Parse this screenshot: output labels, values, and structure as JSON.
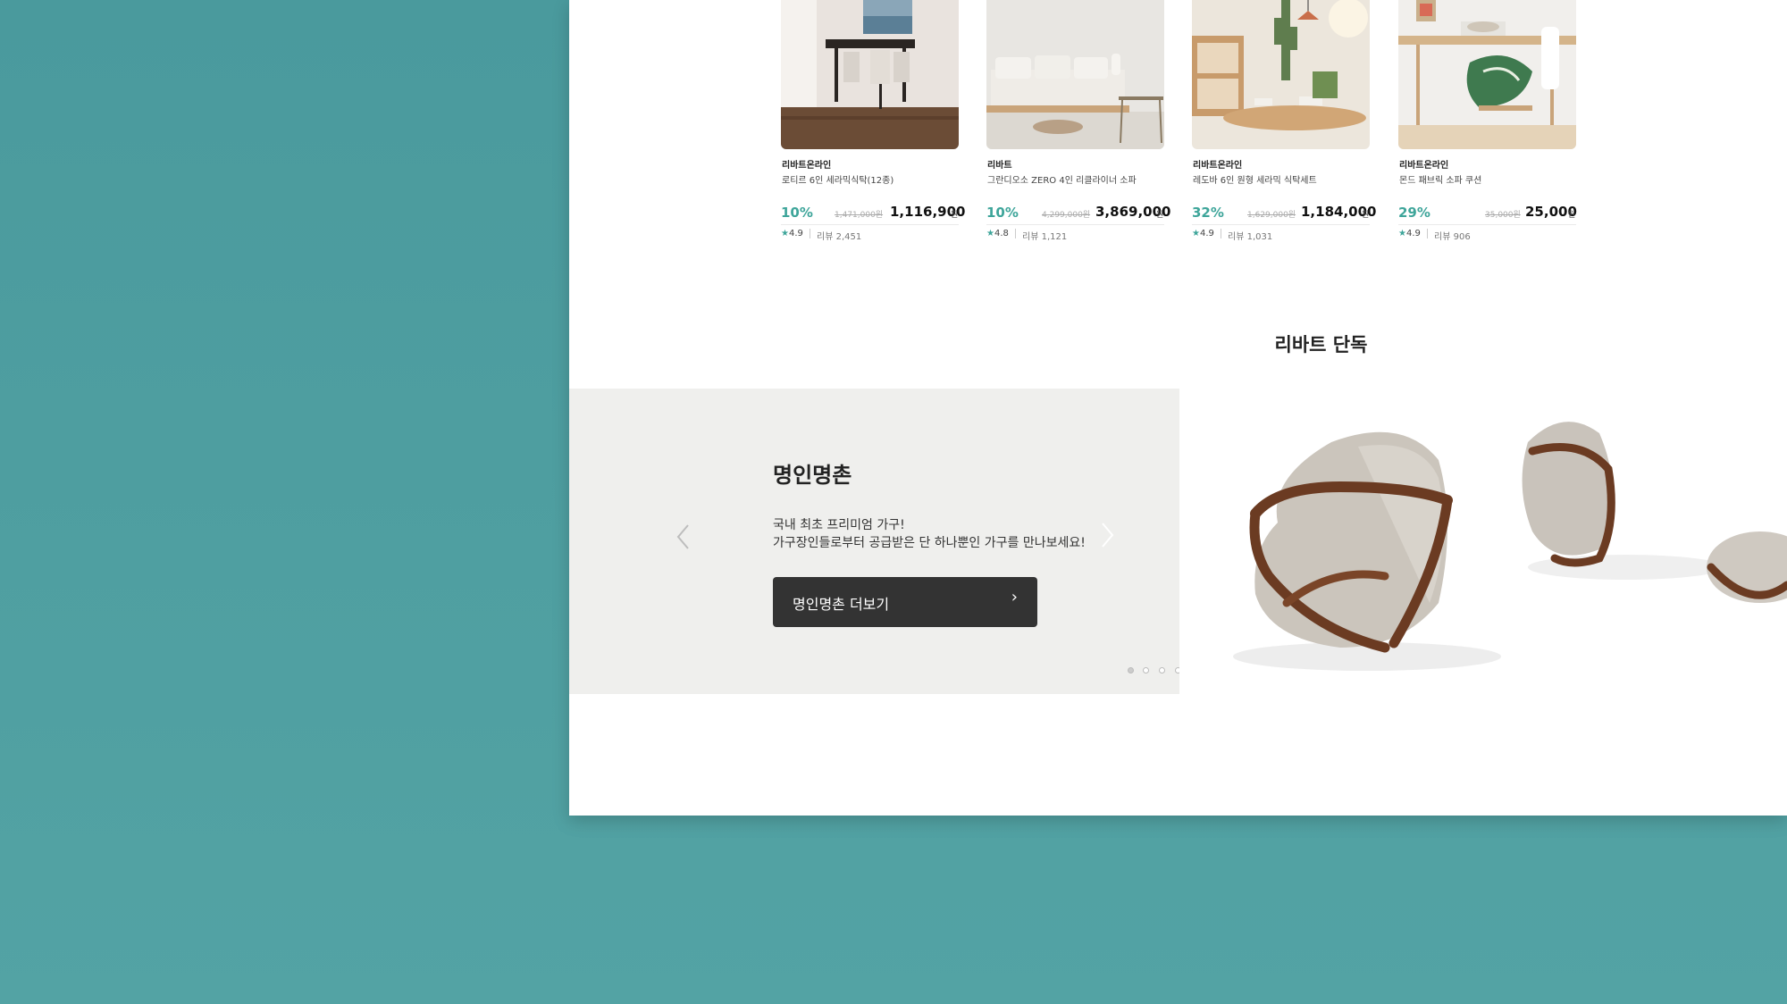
{
  "products": [
    {
      "brand": "리바트온라인",
      "name": "로티르 6인 세라믹식탁(12종)",
      "discount": "10%",
      "original_price": "1,471,000원",
      "price": "1,116,900",
      "currency": "원",
      "rating": "4.9",
      "reviews_label": "리뷰",
      "reviews": "2,451"
    },
    {
      "brand": "리바트",
      "name": "그란디오소 ZERO 4인 리클라이너 소파",
      "discount": "10%",
      "original_price": "4,299,000원",
      "price": "3,869,000",
      "currency": "원",
      "rating": "4.8",
      "reviews_label": "리뷰",
      "reviews": "1,121"
    },
    {
      "brand": "리바트온라인",
      "name": "레도바 6인 원형 세라믹 식탁세트",
      "discount": "32%",
      "original_price": "1,629,000원",
      "price": "1,184,000",
      "currency": "원",
      "rating": "4.9",
      "reviews_label": "리뷰",
      "reviews": "1,031"
    },
    {
      "brand": "리바트온라인",
      "name": "몬드 패브릭 소파 쿠션",
      "discount": "29%",
      "original_price": "35,000원",
      "price": "25,000",
      "currency": "원",
      "rating": "4.9",
      "reviews_label": "리뷰",
      "reviews": "906"
    }
  ],
  "section": {
    "title": "리바트 단독"
  },
  "banner": {
    "title": "명인명촌",
    "desc1": "국내 최초 프리미엄 가구!",
    "desc2": "가구장인들로부터 공급받은 단 하나뿐인 가구를 만나보세요!",
    "button_label": "명인명촌 더보기",
    "button_arrow": "›",
    "slide_count": 7,
    "active_slide": 1
  },
  "icons": {
    "star": "star-icon",
    "prev": "chevron-left-icon",
    "next": "chevron-right-icon"
  },
  "colors": {
    "accent": "#3ea59a",
    "background": "#4f9fa1",
    "button": "#333333"
  }
}
